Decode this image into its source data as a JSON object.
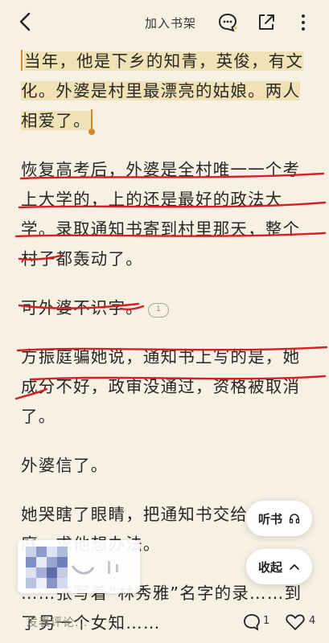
{
  "topbar": {
    "add_to_shelf": "加入书架",
    "icons": [
      "back-arrow-icon",
      "comment-bubble-icon",
      "share-icon",
      "more-vertical-icon"
    ]
  },
  "content": {
    "p1": "当年，他是下乡的知青，英俊，有文化。外婆是村里最漂亮的姑娘。两人相爱了。",
    "p2": "恢复高考后，外婆是全村唯一一个考上大学的，上的还是最好的政法大学。录取通知书寄到村里那天，整个村子都轰动了。",
    "p3": "可外婆不识字。",
    "p3_comment_count": "1",
    "p4": "方振庭骗她说，通知书上写的是，她成分不好，政审没通过，资格被取消了。",
    "p5": "外婆信了。",
    "p6": "她哭瞎了眼睛，把通知书交给了方振庭，求他想办法。",
    "p7": "……张写着“林秀雅”名字的录……到了另一个女知……"
  },
  "buttons": {
    "listen": "听书",
    "collapse": "收起"
  },
  "bottombar": {
    "comment_placeholder": "发表评论...",
    "comment_count": "1",
    "like_count": "4"
  },
  "colors": {
    "background": "#f6f1e4",
    "highlight": "#efe2b6",
    "selection_handle": "#d48a25",
    "ink_underline": "#d81e22"
  }
}
